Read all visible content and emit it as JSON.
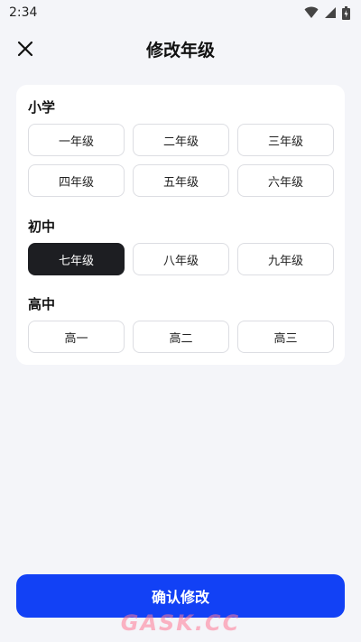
{
  "status_bar": {
    "time": "2:34"
  },
  "header": {
    "title": "修改年级"
  },
  "sections": [
    {
      "title": "小学",
      "grades": [
        "一年级",
        "二年级",
        "三年级",
        "四年级",
        "五年级",
        "六年级"
      ]
    },
    {
      "title": "初中",
      "grades": [
        "七年级",
        "八年级",
        "九年级"
      ]
    },
    {
      "title": "高中",
      "grades": [
        "高一",
        "高二",
        "高三"
      ]
    }
  ],
  "selected_grade": "七年级",
  "confirm_button": {
    "label": "确认修改"
  },
  "watermark": "GASK.CC",
  "colors": {
    "accent": "#1241f5",
    "selected": "#1d1e22",
    "background": "#f4f5f9"
  }
}
